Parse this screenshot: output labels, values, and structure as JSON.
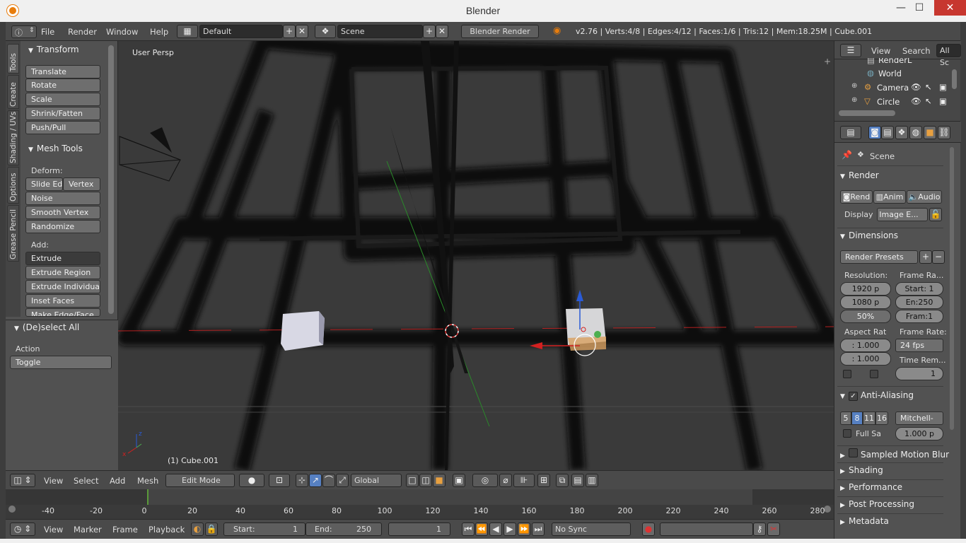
{
  "window": {
    "title": "Blender",
    "min": "—",
    "max": "☐",
    "close": "✕"
  },
  "info": {
    "menus": [
      "File",
      "Render",
      "Window",
      "Help"
    ],
    "layout": "Default",
    "scene": "Scene",
    "engine": "Blender Render",
    "stats": "v2.76 | Verts:4/8 | Edges:4/12 | Faces:1/6 | Tris:12 | Mem:18.25M | Cube.001"
  },
  "toolshelf": {
    "tabs": [
      "Tools",
      "Create",
      "Shading / UVs",
      "Options",
      "Grease Pencil"
    ],
    "transform_title": "Transform",
    "transform": [
      "Translate",
      "Rotate",
      "Scale",
      "Shrink/Fatten",
      "Push/Pull"
    ],
    "mesh_tools_title": "Mesh Tools",
    "deform_label": "Deform:",
    "slide_edge": "Slide Ed",
    "vertex": "Vertex",
    "deform": [
      "Noise",
      "Smooth Vertex",
      "Randomize"
    ],
    "add_label": "Add:",
    "extrude": "Extrude",
    "add": [
      "Extrude Region",
      "Extrude Individual",
      "Inset Faces",
      "Make Edge/Face"
    ]
  },
  "operator": {
    "title": "(De)select All",
    "action_label": "Action",
    "action_value": "Toggle"
  },
  "viewport": {
    "view_name": "User Persp",
    "object_label": "(1) Cube.001"
  },
  "view3d_header": {
    "menus": [
      "View",
      "Select",
      "Add",
      "Mesh"
    ],
    "mode": "Edit Mode",
    "orientation": "Global"
  },
  "timeline": {
    "ticks": [
      "-40",
      "-20",
      "0",
      "20",
      "40",
      "60",
      "80",
      "100",
      "120",
      "140",
      "160",
      "180",
      "200",
      "220",
      "240",
      "260",
      "280"
    ],
    "current_frame": 1,
    "menus": [
      "View",
      "Marker",
      "Frame",
      "Playback"
    ],
    "start_label": "Start:",
    "start": "1",
    "end_label": "End:",
    "end": "250",
    "frame": "1",
    "sync": "No Sync"
  },
  "outliner": {
    "menus": [
      "View",
      "Search"
    ],
    "filter": "All Sc",
    "items": [
      {
        "name": "RenderL",
        "icon": "render-layers-icon"
      },
      {
        "name": "World",
        "icon": "world-icon"
      },
      {
        "name": "Camera",
        "icon": "camera-icon"
      },
      {
        "name": "Circle",
        "icon": "mesh-icon"
      }
    ]
  },
  "properties": {
    "context": "Scene",
    "render_title": "Render",
    "render_btn": "Rend",
    "anim_btn": "Anim",
    "audio_btn": "Audio",
    "display_label": "Display",
    "display_value": "Image E...",
    "dimensions_title": "Dimensions",
    "presets": "Render Presets",
    "resolution_label": "Resolution:",
    "res_x": "1920 p",
    "res_y": "1080 p",
    "res_pct": "50%",
    "frame_range_label": "Frame Ra...",
    "start": "Start: 1",
    "end": "En:250",
    "step": "Fram:1",
    "aspect_label": "Aspect Rat",
    "aspect_x": ": 1.000",
    "aspect_y": ": 1.000",
    "frame_rate_label": "Frame Rate:",
    "fps": "24 fps",
    "time_remap_label": "Time Rem...",
    "time_remap": "1",
    "aa_title": "Anti-Aliasing",
    "aa_samples": [
      "5",
      "8",
      "11",
      "16"
    ],
    "aa_selected": "8",
    "aa_filter": "Mitchell-",
    "full_sample": "Full Sa",
    "filter_size": "1.000 p",
    "collapsed": [
      "Sampled Motion Blur",
      "Shading",
      "Performance",
      "Post Processing",
      "Metadata"
    ]
  },
  "colors": {
    "accent": "#5680c2",
    "x_axis": "#d32020",
    "y_axis": "#4caf50",
    "z_axis": "#2a5bd7",
    "brand": "#e87d0d"
  }
}
